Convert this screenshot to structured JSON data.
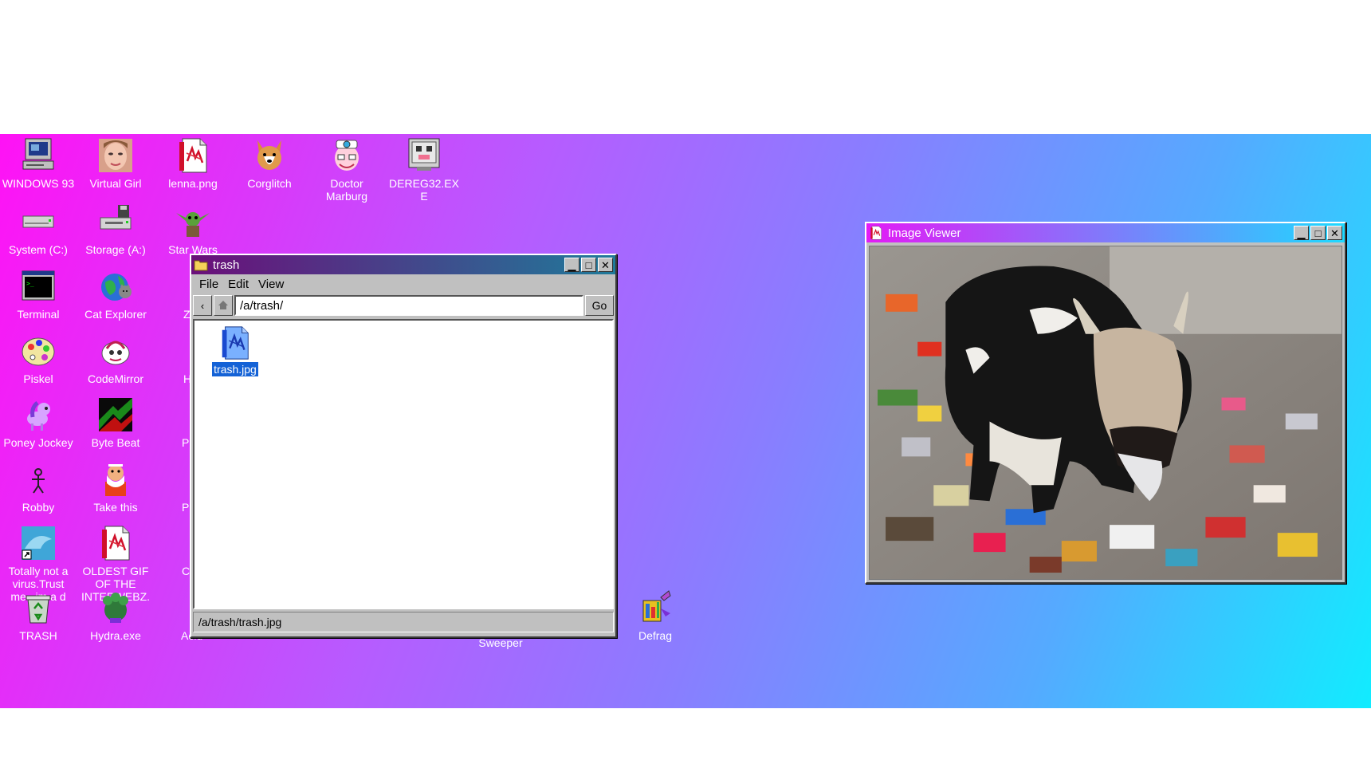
{
  "desktop": {
    "icons": [
      {
        "id": "windows93",
        "label": "WINDOWS 93",
        "icon": "computer-icon"
      },
      {
        "id": "virtual-girl",
        "label": "Virtual Girl",
        "icon": "face-icon"
      },
      {
        "id": "lenna",
        "label": "lenna.png",
        "icon": "image-file-icon"
      },
      {
        "id": "corglitch",
        "label": "Corglitch",
        "icon": "corgi-icon"
      },
      {
        "id": "doctor-marburg",
        "label": "Doctor Marburg",
        "icon": "doctor-icon"
      },
      {
        "id": "dereg32",
        "label": "DEREG32.EXE",
        "icon": "robot-monitor-icon"
      },
      {
        "id": "system-c",
        "label": "System (C:)",
        "icon": "drive-icon"
      },
      {
        "id": "storage-a",
        "label": "Storage (A:)",
        "icon": "floppy-drive-icon"
      },
      {
        "id": "star-wars",
        "label": "Star Wars",
        "icon": "yoda-icon"
      },
      {
        "id": "terminal",
        "label": "Terminal",
        "icon": "terminal-icon"
      },
      {
        "id": "cat-explorer",
        "label": "Cat Explorer",
        "icon": "globe-cat-icon"
      },
      {
        "id": "zk",
        "label": "Zk",
        "icon": "blue-app-icon"
      },
      {
        "id": "piskel",
        "label": "Piskel",
        "icon": "palette-icon"
      },
      {
        "id": "codemirror",
        "label": "CodeMirror",
        "icon": "codemirror-icon"
      },
      {
        "id": "he",
        "label": "He",
        "icon": "hex-icon"
      },
      {
        "id": "poney-jockey",
        "label": "Poney Jockey",
        "icon": "pony-icon"
      },
      {
        "id": "byte-beat",
        "label": "Byte Beat",
        "icon": "bytebeat-icon"
      },
      {
        "id": "puke",
        "label": "Puke",
        "icon": "puke-icon"
      },
      {
        "id": "robby",
        "label": "Robby",
        "icon": "stick-figure-icon"
      },
      {
        "id": "take-this",
        "label": "Take this",
        "icon": "old-man-icon"
      },
      {
        "id": "poke",
        "label": "Poke",
        "icon": "poke-icon"
      },
      {
        "id": "totally-not-virus",
        "label": "Totally not a virus.Trust me...im a d",
        "icon": "dolphin-icon"
      },
      {
        "id": "oldest-gif",
        "label": "OLDEST GIF OF THE INTERWEBZ.gif",
        "icon": "image-file-icon"
      },
      {
        "id": "cont",
        "label": "Cont",
        "icon": "window-icon"
      },
      {
        "id": "trash",
        "label": "TRASH",
        "icon": "recycle-bin-icon"
      },
      {
        "id": "hydra",
        "label": "Hydra.exe",
        "icon": "hydra-icon"
      },
      {
        "id": "acid",
        "label": "Acid I",
        "icon": "acid-icon"
      },
      {
        "id": "sweeper",
        "label": "Sweeper",
        "icon": "minesweeper-icon"
      },
      {
        "id": "defrag",
        "label": "Defrag",
        "icon": "defrag-icon"
      }
    ]
  },
  "trash_window": {
    "title": "trash",
    "title_icon": "folder-icon",
    "menu": [
      "File",
      "Edit",
      "View"
    ],
    "back_glyph": "‹",
    "home_icon": "home-icon",
    "path_value": "/a/trash/",
    "go_label": "Go",
    "files": [
      {
        "name": "trash.jpg",
        "icon": "image-file-icon",
        "selected": true
      }
    ],
    "status": "/a/trash/trash.jpg"
  },
  "image_viewer": {
    "title": "Image Viewer",
    "title_icon": "image-file-icon",
    "image": "cow eating from garbage"
  },
  "window_controls": {
    "minimize": "▁",
    "maximize": "□",
    "close": "✕"
  },
  "colors": {
    "trash_title_from": "#6b0f7a",
    "trash_title_to": "#1f7a9a",
    "viewer_title_from": "#e21bf6",
    "viewer_title_to": "#1ed9ff",
    "selection": "#1462d6"
  }
}
